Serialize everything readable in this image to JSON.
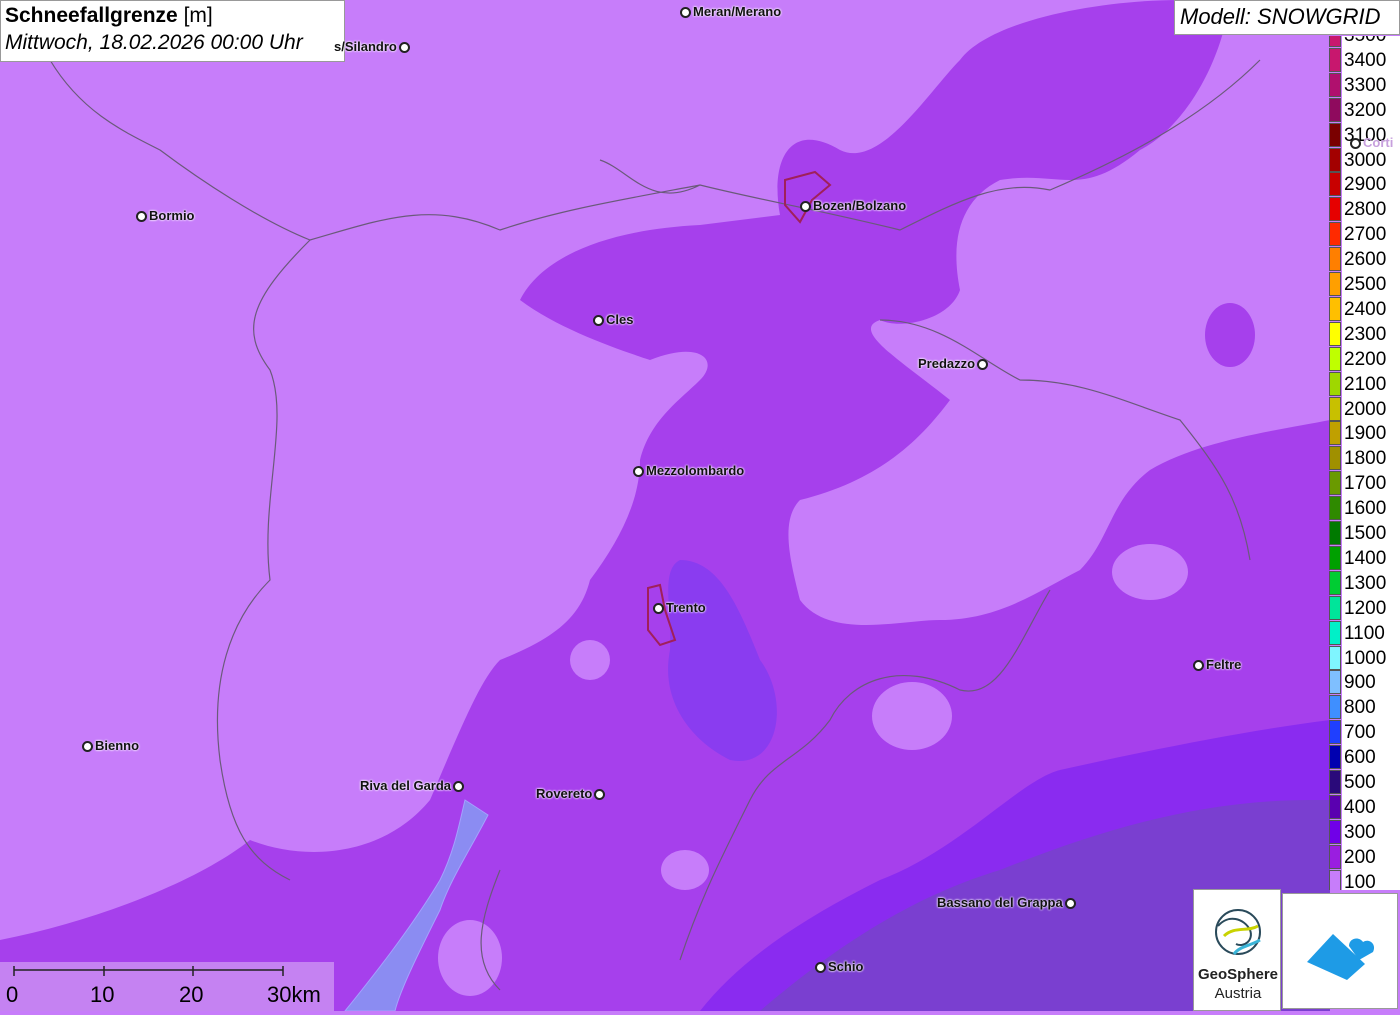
{
  "title": {
    "main": "Schneefallgrenze",
    "unit": "[m]",
    "date": "Mittwoch, 18.02.2026 00:00 Uhr"
  },
  "model_label": "Modell: SNOWGRID",
  "legend": [
    {
      "label": "3500",
      "color": "#c8176e"
    },
    {
      "label": "3400",
      "color": "#c8176e"
    },
    {
      "label": "3300",
      "color": "#b0106e"
    },
    {
      "label": "3200",
      "color": "#8f0a5e"
    },
    {
      "label": "3100",
      "color": "#7a0000"
    },
    {
      "label": "3000",
      "color": "#a30000"
    },
    {
      "label": "2900",
      "color": "#c80000"
    },
    {
      "label": "2800",
      "color": "#e60000"
    },
    {
      "label": "2700",
      "color": "#ff2a00"
    },
    {
      "label": "2600",
      "color": "#ff7f00"
    },
    {
      "label": "2500",
      "color": "#ff9f00"
    },
    {
      "label": "2400",
      "color": "#ffbf00"
    },
    {
      "label": "2300",
      "color": "#ffff00"
    },
    {
      "label": "2200",
      "color": "#bfff00"
    },
    {
      "label": "2100",
      "color": "#9fd700"
    },
    {
      "label": "2000",
      "color": "#c8c000"
    },
    {
      "label": "1900",
      "color": "#c0a000"
    },
    {
      "label": "1800",
      "color": "#a09000"
    },
    {
      "label": "1700",
      "color": "#6a9a00"
    },
    {
      "label": "1600",
      "color": "#2f8a00"
    },
    {
      "label": "1500",
      "color": "#007a00"
    },
    {
      "label": "1400",
      "color": "#00a000"
    },
    {
      "label": "1300",
      "color": "#00cc33"
    },
    {
      "label": "1200",
      "color": "#00e59a"
    },
    {
      "label": "1100",
      "color": "#00f0c8"
    },
    {
      "label": "1000",
      "color": "#7ff5ff"
    },
    {
      "label": "900",
      "color": "#7fbfff"
    },
    {
      "label": "800",
      "color": "#3f8fff"
    },
    {
      "label": "700",
      "color": "#1f3fff"
    },
    {
      "label": "600",
      "color": "#0000b0"
    },
    {
      "label": "500",
      "color": "#2a0a7a"
    },
    {
      "label": "400",
      "color": "#5a00b0"
    },
    {
      "label": "300",
      "color": "#7000e8"
    },
    {
      "label": "200",
      "color": "#9a1ee0"
    },
    {
      "label": "100",
      "color": "#c77dfa"
    }
  ],
  "cities": [
    {
      "name": "Meran/Merano"
    },
    {
      "name": "s/Silandro"
    },
    {
      "name": "Bormio"
    },
    {
      "name": "Bozen/Bolzano"
    },
    {
      "name": "Cles"
    },
    {
      "name": "Predazzo"
    },
    {
      "name": "Mezzolombardo"
    },
    {
      "name": "Trento"
    },
    {
      "name": "Feltre"
    },
    {
      "name": "Bienno"
    },
    {
      "name": "Riva del Garda"
    },
    {
      "name": "Rovereto"
    },
    {
      "name": "Bassano del Grappa"
    },
    {
      "name": "Schio"
    },
    {
      "name": "Corti"
    }
  ],
  "scalebar": {
    "labels": [
      "0",
      "10",
      "20",
      "30km"
    ]
  },
  "logo": {
    "name": "GeoSphere",
    "sub": "Austria",
    "icon": "geosphere-logo-icon",
    "app_icon": "snow-cloud-icon"
  },
  "colors": {
    "zone_100": "#c77dfa",
    "zone_200": "#a640ec",
    "zone_300": "#8a2bf0",
    "zone_dark": "#7a3fd0"
  }
}
